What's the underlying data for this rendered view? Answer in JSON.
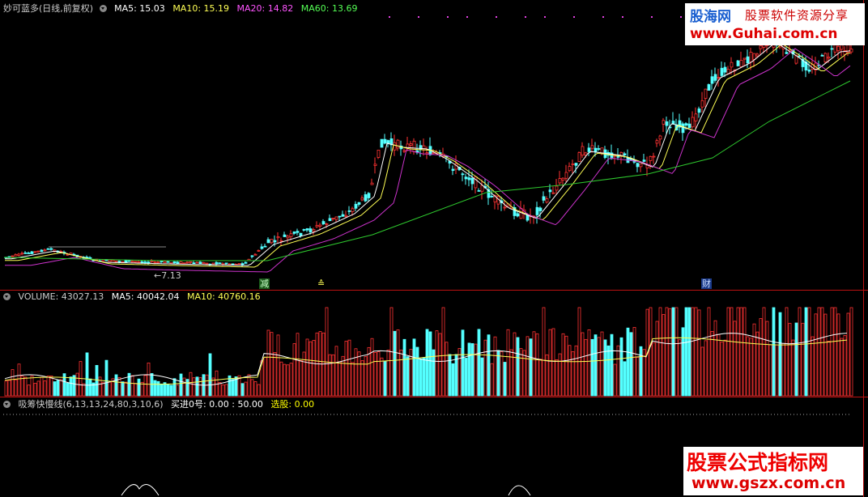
{
  "main": {
    "stock_name": "妙可蓝多(日线,前复权)",
    "ma_items": [
      {
        "label": "MA5: 15.03",
        "color": "#ffffff"
      },
      {
        "label": "MA10: 15.19",
        "color": "#ffff55"
      },
      {
        "label": "MA20: 14.82",
        "color": "#ff55ff"
      },
      {
        "label": "MA60: 13.69",
        "color": "#55ff55"
      }
    ],
    "low_label": "←7.13",
    "tags": {
      "left": "减",
      "mid": "≙",
      "right": "财"
    }
  },
  "volume": {
    "items": [
      {
        "label": "VOLUME: 43027.13",
        "color": "#cccccc"
      },
      {
        "label": "MA5: 40042.04",
        "color": "#ffffff"
      },
      {
        "label": "MA10: 40760.16",
        "color": "#ffff55"
      }
    ]
  },
  "indicator": {
    "name": "吸筹快慢线(6,13,13,24,80,3,10,6)",
    "items": [
      {
        "label": "买进0号: 0.00 : 50.00",
        "color": "#ffffff"
      },
      {
        "label": "选股: 0.00",
        "color": "#ffff00"
      }
    ]
  },
  "watermark_top": {
    "brand": "股海网",
    "slogan": "股票软件资源分享",
    "url": "www.Guhai.com.cn"
  },
  "watermark_bottom": {
    "title": "股票公式指标网",
    "url": "www.gszx.com.cn"
  },
  "colors": {
    "up": "#ff3232",
    "down": "#54ffff",
    "separator": "#b01010",
    "ma60": "#2ec82e",
    "ma20": "#cc33cc"
  }
}
